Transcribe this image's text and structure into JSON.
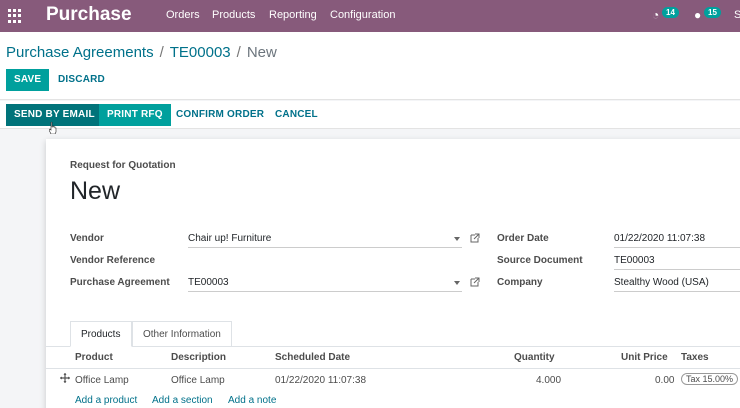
{
  "navbar": {
    "brand": "Purchase",
    "menu": [
      "Orders",
      "Products",
      "Reporting",
      "Configuration"
    ],
    "activity_count": "14",
    "messages_count": "15",
    "user_initial": "S"
  },
  "breadcrumb": {
    "root": "Purchase Agreements",
    "parent": "TE00003",
    "current": "New"
  },
  "buttons": {
    "save": "SAVE",
    "discard": "DISCARD",
    "send_email": "SEND BY EMAIL",
    "print_rfq": "PRINT RFQ",
    "confirm": "CONFIRM ORDER",
    "cancel": "CANCEL"
  },
  "form": {
    "doc_type": "Request for Quotation",
    "doc_name": "New",
    "vendor_label": "Vendor",
    "vendor_value": "Chair up! Furniture",
    "vendor_ref_label": "Vendor Reference",
    "vendor_ref_value": "",
    "agreement_label": "Purchase Agreement",
    "agreement_value": "TE00003",
    "order_date_label": "Order Date",
    "order_date_value": "01/22/2020 11:07:38",
    "source_label": "Source Document",
    "source_value": "TE00003",
    "company_label": "Company",
    "company_value": "Stealthy Wood (USA)"
  },
  "tabs": [
    "Products",
    "Other Information"
  ],
  "table": {
    "headers": [
      "Product",
      "Description",
      "Scheduled Date",
      "Quantity",
      "Unit Price",
      "Taxes"
    ],
    "rows": [
      {
        "product": "Office Lamp",
        "description": "Office Lamp",
        "date": "01/22/2020 11:07:38",
        "quantity": "4.000",
        "price": "0.00",
        "tax": "Tax 15.00%"
      }
    ],
    "add_product": "Add a product",
    "add_section": "Add a section",
    "add_note": "Add a note"
  },
  "colors": {
    "navbar": "#875a7b",
    "primary": "#00a09d",
    "link": "#00718a"
  }
}
